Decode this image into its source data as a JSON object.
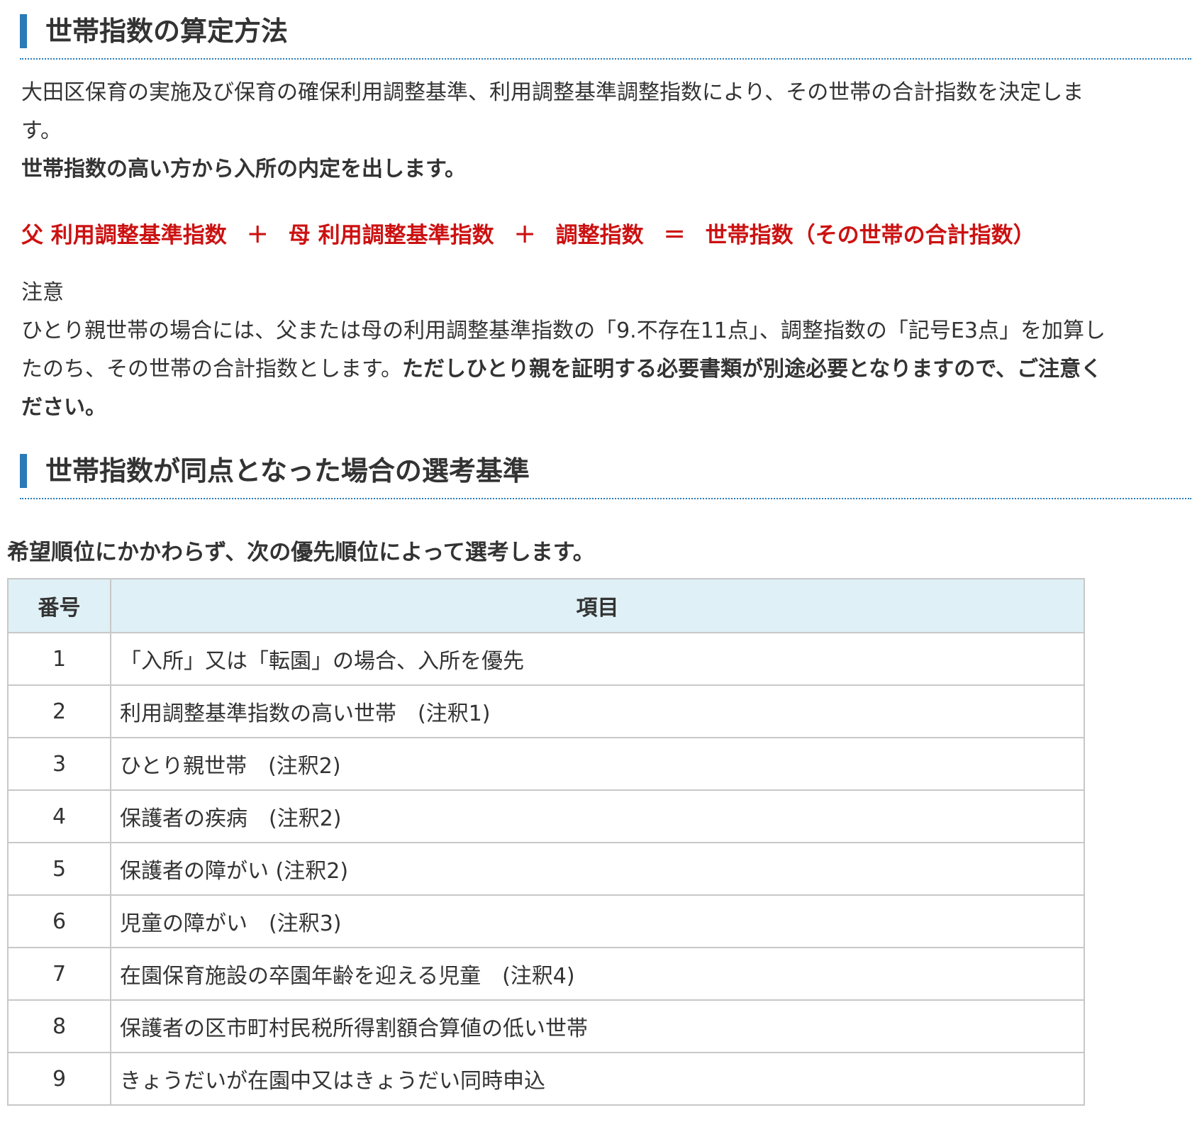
{
  "section1": {
    "title": "世帯指数の算定方法",
    "intro_line1": "大田区保育の実施及び保育の確保利用調整基準、利用調整基準調整指数により、その世帯の合計指数を決定しま",
    "intro_line2": "す。",
    "intro_bold": "世帯指数の高い方から入所の内定を出します。",
    "formula": {
      "term1": "父 利用調整基準指数",
      "plus1": "＋",
      "term2": "母 利用調整基準指数",
      "plus2": "＋",
      "term3": "調整指数",
      "equals": "＝",
      "result": "世帯指数（その世帯の合計指数）",
      "color": "#cc1111"
    },
    "note_label": "注意",
    "note_line1": "ひとり親世帯の場合には、父または母の利用調整基準指数の「9.不存在11点」、調整指数の「記号E3点」を加算し",
    "note_line2_normal": "たのち、その世帯の合計指数とします。",
    "note_line2_bold": "ただしひとり親を証明する必要書類が別途必要となりますので、ご注意く",
    "note_line3_bold": "ださい。"
  },
  "section2": {
    "title": "世帯指数が同点となった場合の選考基準",
    "lead": "希望順位にかかわらず、次の優先順位によって選考します。",
    "table": {
      "headers": [
        "番号",
        "項目"
      ],
      "rows": [
        [
          "1",
          "「入所」又は「転園」の場合、入所を優先"
        ],
        [
          "2",
          "利用調整基準指数の高い世帯　(注釈1)"
        ],
        [
          "3",
          "ひとり親世帯　(注釈2)"
        ],
        [
          "4",
          "保護者の疾病　(注釈2)"
        ],
        [
          "5",
          "保護者の障がい (注釈2)"
        ],
        [
          "6",
          "児童の障がい　(注釈3)"
        ],
        [
          "7",
          "在園保育施設の卒園年齢を迎える児童　(注釈4)"
        ],
        [
          "8",
          "保護者の区市町村民税所得割額合算値の低い世帯"
        ],
        [
          "9",
          "きょうだいが在園中又はきょうだい同時申込"
        ]
      ]
    }
  },
  "colors": {
    "accent": "#2a7ab8",
    "header_bg": "#dff0f6",
    "formula_red": "#cc1111"
  }
}
